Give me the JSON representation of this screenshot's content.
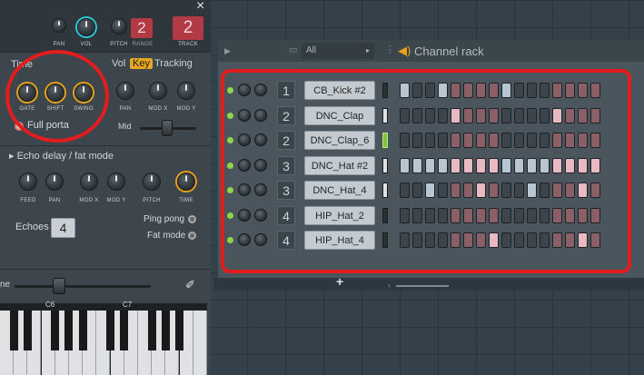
{
  "top": {
    "pan": "PAN",
    "vol": "VOL",
    "pitch": "PITCH",
    "range": "RANGE",
    "range_value": "2",
    "track": "TRACK",
    "track_value": "2"
  },
  "close_glyph": "×",
  "time_section": {
    "title": "Time",
    "gate": "GATE",
    "shift": "SHIFT",
    "swing": "SWING",
    "full_porta": "Full porta"
  },
  "tabs": {
    "vol": "Vol",
    "key": "Key",
    "tracking": "Tracking"
  },
  "tracking": {
    "pan": "PAN",
    "mod_x": "MOD X",
    "mod_y": "MOD Y",
    "mid": "Mid"
  },
  "echo": {
    "title": "Echo delay / fat mode",
    "feed": "FEED",
    "pan": "PAN",
    "mod_x": "MOD X",
    "mod_y": "MOD Y",
    "pitch": "PITCH",
    "time": "TIME",
    "echoes_label": "Echoes",
    "echoes_value": "4",
    "ping_pong": "Ping pong",
    "fat_mode": "Fat mode"
  },
  "bottom_label_fragment": "ne",
  "piano": {
    "c6": "C6",
    "c7": "C7"
  },
  "rack": {
    "filter": "All",
    "title": "Channel rack",
    "add": "+"
  },
  "channels": [
    {
      "num": "1",
      "name": "CB_Kick #2",
      "meter": "dark",
      "steps": [
        1,
        0,
        0,
        1,
        0,
        0,
        0,
        0,
        1,
        0,
        0,
        0,
        0,
        0,
        0,
        0
      ]
    },
    {
      "num": "2",
      "name": "DNC_Clap",
      "meter": "hi",
      "steps": [
        0,
        0,
        0,
        0,
        1,
        0,
        0,
        0,
        0,
        0,
        0,
        0,
        1,
        0,
        0,
        0
      ]
    },
    {
      "num": "2",
      "name": "DNC_Clap_6",
      "meter": "green",
      "steps": [
        0,
        0,
        0,
        0,
        0,
        0,
        0,
        0,
        0,
        0,
        0,
        0,
        0,
        0,
        0,
        0
      ]
    },
    {
      "num": "3",
      "name": "DNC_Hat #2",
      "meter": "hi",
      "steps": [
        1,
        1,
        1,
        1,
        1,
        1,
        1,
        1,
        1,
        1,
        1,
        1,
        1,
        1,
        1,
        1
      ]
    },
    {
      "num": "3",
      "name": "DNC_Hat_4",
      "meter": "hi",
      "steps": [
        0,
        0,
        1,
        0,
        0,
        0,
        1,
        0,
        0,
        0,
        1,
        0,
        0,
        0,
        1,
        0
      ]
    },
    {
      "num": "4",
      "name": "HIP_Hat_2",
      "meter": "dark",
      "steps": [
        0,
        0,
        0,
        0,
        0,
        0,
        0,
        0,
        0,
        0,
        0,
        0,
        0,
        0,
        0,
        0
      ]
    },
    {
      "num": "4",
      "name": "HIP_Hat_4",
      "meter": "dark",
      "steps": [
        0,
        0,
        0,
        0,
        0,
        0,
        0,
        1,
        0,
        0,
        0,
        0,
        0,
        0,
        1,
        0
      ]
    }
  ],
  "colors": {
    "highlight_red": "#e11d1d",
    "accent_orange": "#e8a21b",
    "accent_cyan": "#2fc6d6"
  }
}
